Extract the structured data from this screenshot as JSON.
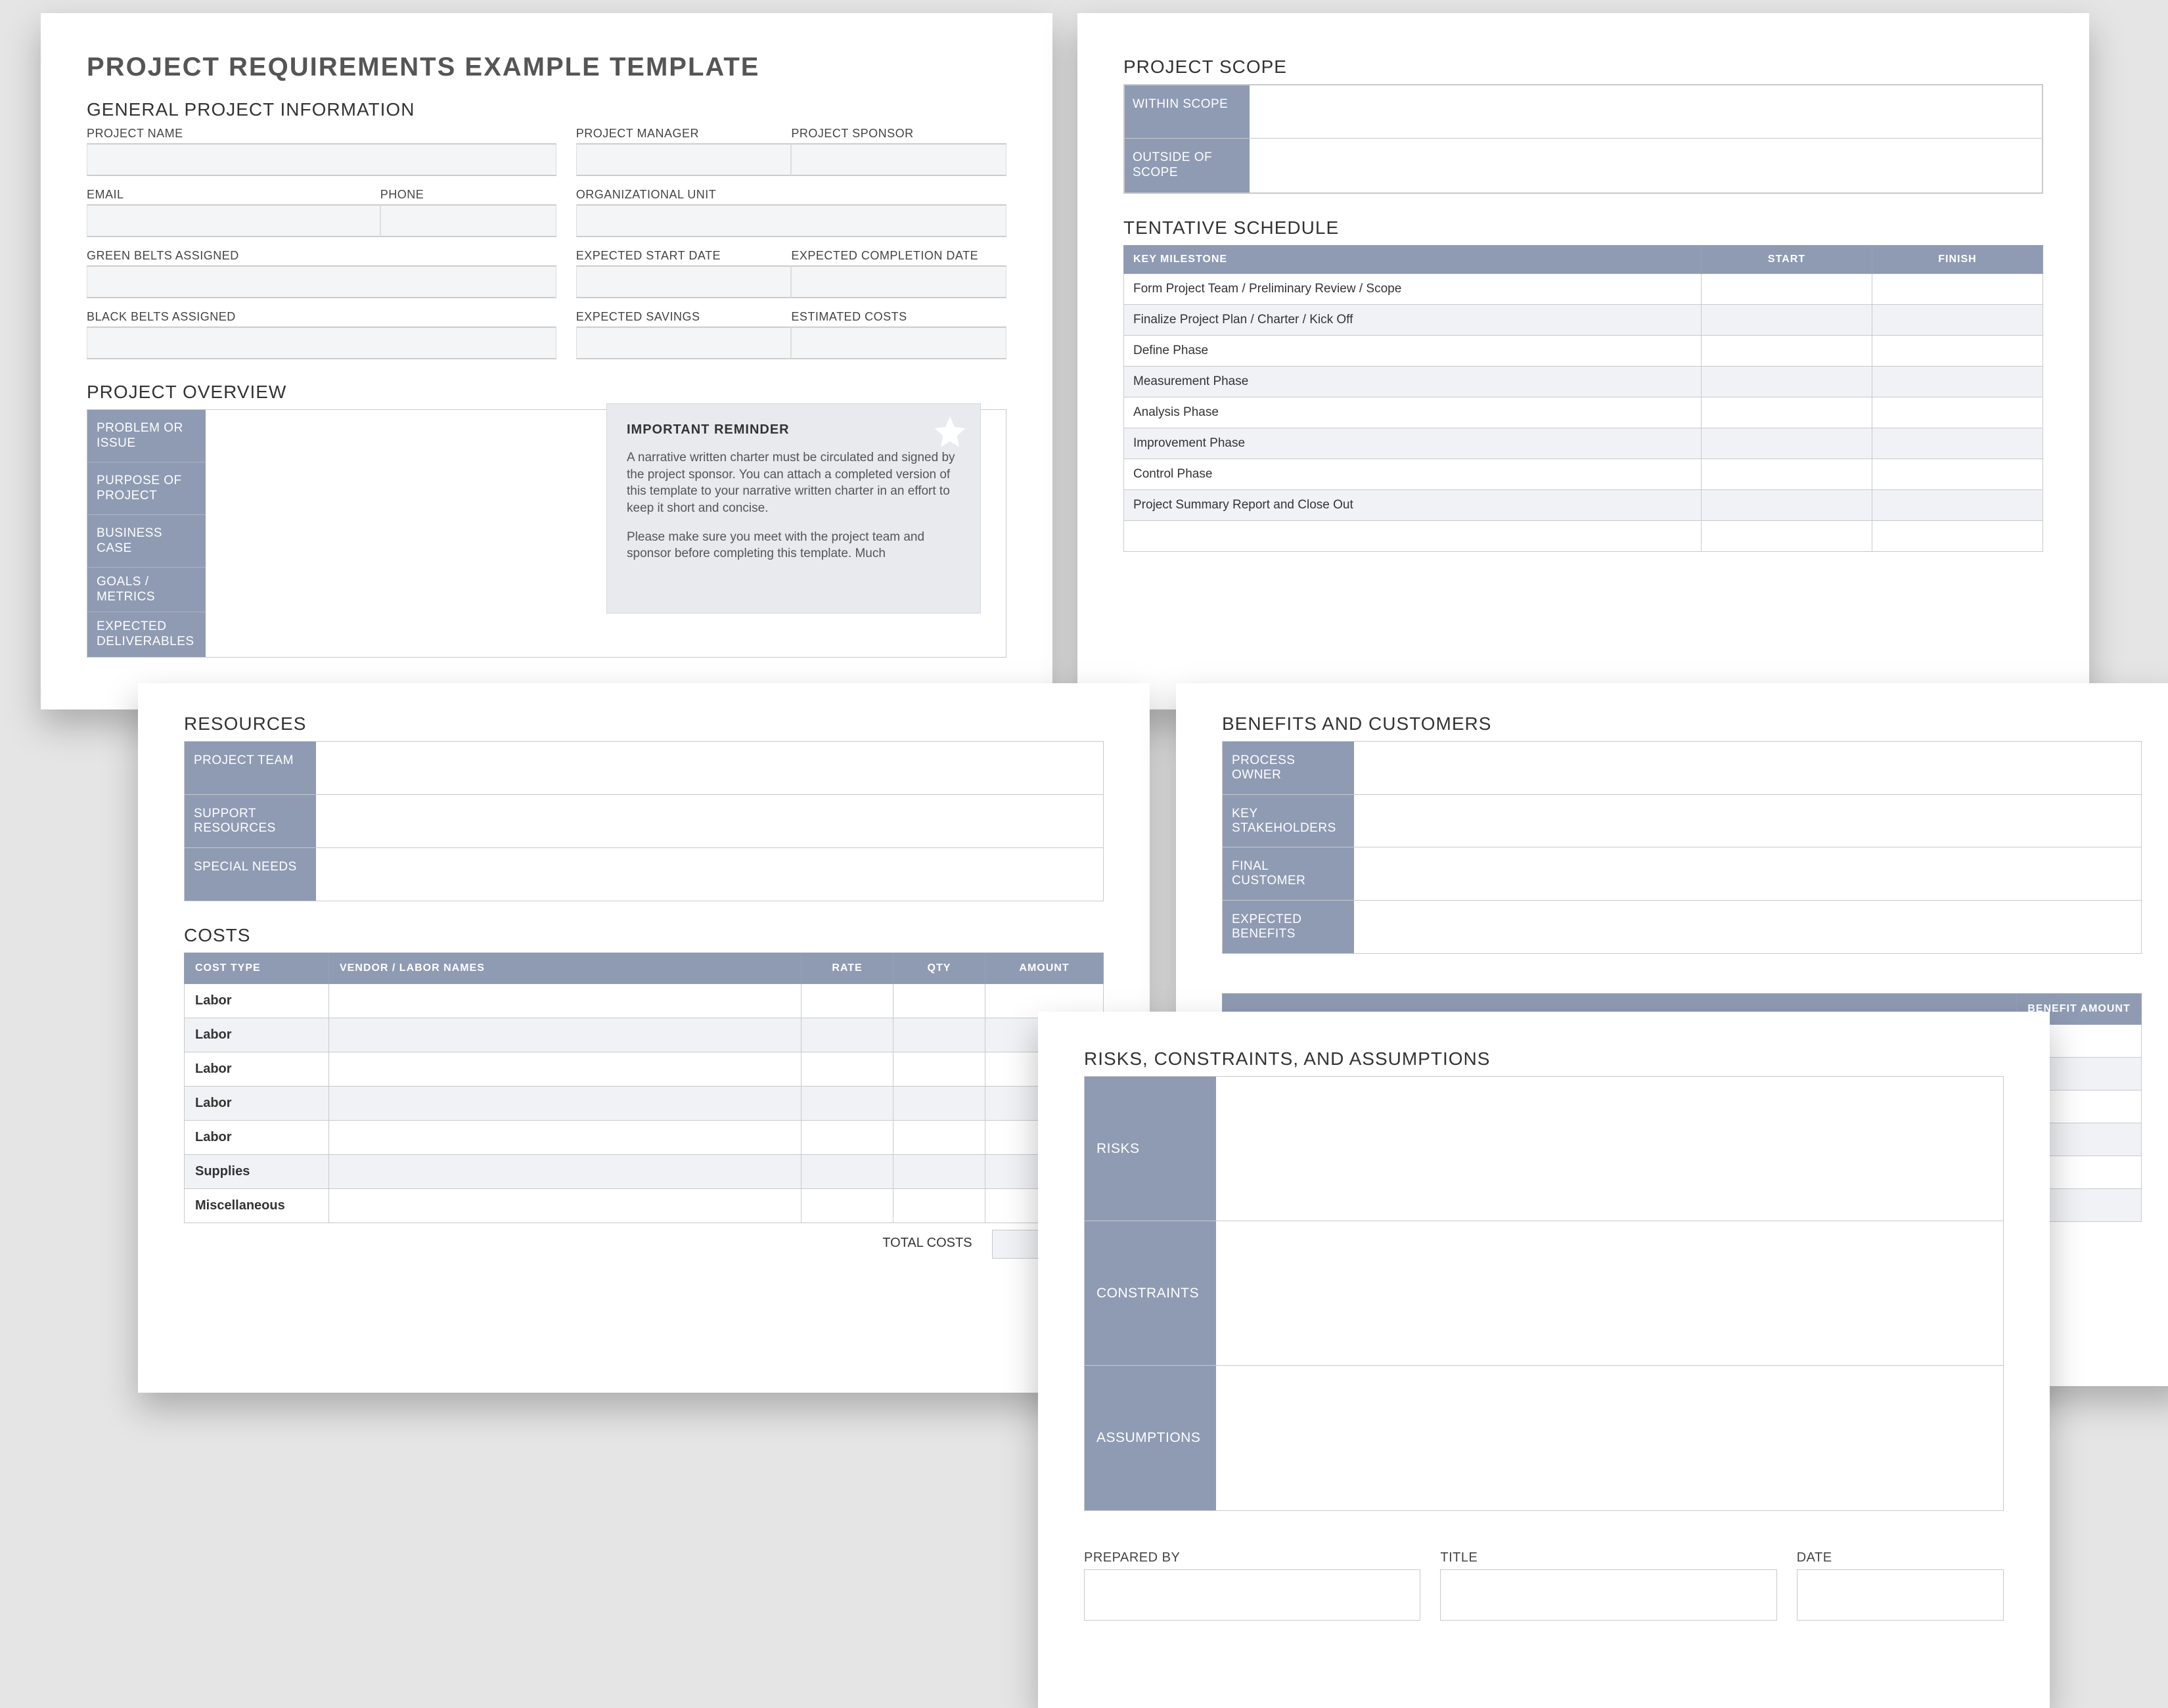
{
  "page1": {
    "title": "PROJECT REQUIREMENTS EXAMPLE TEMPLATE",
    "generalHeading": "GENERAL PROJECT INFORMATION",
    "fields": {
      "projectName": "PROJECT NAME",
      "projectManager": "PROJECT MANAGER",
      "projectSponsor": "PROJECT SPONSOR",
      "email": "EMAIL",
      "phone": "PHONE",
      "orgUnit": "ORGANIZATIONAL UNIT",
      "green": "GREEN BELTS ASSIGNED",
      "expectedStart": "EXPECTED START DATE",
      "expectedCompletion": "EXPECTED COMPLETION DATE",
      "black": "BLACK BELTS ASSIGNED",
      "expectedSavings": "EXPECTED SAVINGS",
      "estimatedCosts": "ESTIMATED COSTS"
    },
    "overviewHeading": "PROJECT OVERVIEW",
    "overviewTabs": [
      "PROBLEM OR ISSUE",
      "PURPOSE OF PROJECT",
      "BUSINESS CASE",
      "GOALS / METRICS",
      "EXPECTED DELIVERABLES"
    ],
    "callout": {
      "title": "IMPORTANT REMINDER",
      "body1": "A narrative written charter must be circulated and signed by the project sponsor. You can attach a completed version of this template to your narrative written charter in an effort to keep it short and concise.",
      "body2": "Please make sure you meet with the project team and sponsor before completing this template. Much"
    }
  },
  "page2": {
    "scopeHeading": "PROJECT SCOPE",
    "withinScope": "WITHIN SCOPE",
    "outsideScope": "OUTSIDE OF SCOPE",
    "scheduleHeading": "TENTATIVE SCHEDULE",
    "headers": {
      "milestone": "KEY MILESTONE",
      "start": "START",
      "finish": "FINISH"
    },
    "rows": [
      "Form Project Team / Preliminary Review / Scope",
      "Finalize Project Plan / Charter / Kick Off",
      "Define Phase",
      "Measurement Phase",
      "Analysis Phase",
      "Improvement Phase",
      "Control Phase",
      "Project Summary Report and Close Out"
    ]
  },
  "page3": {
    "resourcesHeading": "RESOURCES",
    "resTabs": {
      "team": "PROJECT TEAM",
      "support": "SUPPORT RESOURCES",
      "special": "SPECIAL NEEDS"
    },
    "costsHeading": "COSTS",
    "costsHeaders": {
      "type": "COST TYPE",
      "vendor": "VENDOR / LABOR NAMES",
      "rate": "RATE",
      "qty": "QTY",
      "amount": "AMOUNT"
    },
    "costsRows": [
      "Labor",
      "Labor",
      "Labor",
      "Labor",
      "Labor",
      "Supplies",
      "Miscellaneous"
    ],
    "totalCosts": "TOTAL COSTS"
  },
  "page4": {
    "heading": "BENEFITS AND CUSTOMERS",
    "tabs": {
      "owner": "PROCESS OWNER",
      "stake": "KEY STAKEHOLDERS",
      "final": "FINAL CUSTOMER",
      "expected": "EXPECTED BENEFITS"
    },
    "benefitAmount": "BENEFIT AMOUNT"
  },
  "page5": {
    "heading": "RISKS, CONSTRAINTS, AND ASSUMPTIONS",
    "labels": {
      "risks": "RISKS",
      "constraints": "CONSTRAINTS",
      "assumptions": "ASSUMPTIONS"
    },
    "sig": {
      "prepared": "PREPARED BY",
      "title": "TITLE",
      "date": "DATE"
    }
  }
}
